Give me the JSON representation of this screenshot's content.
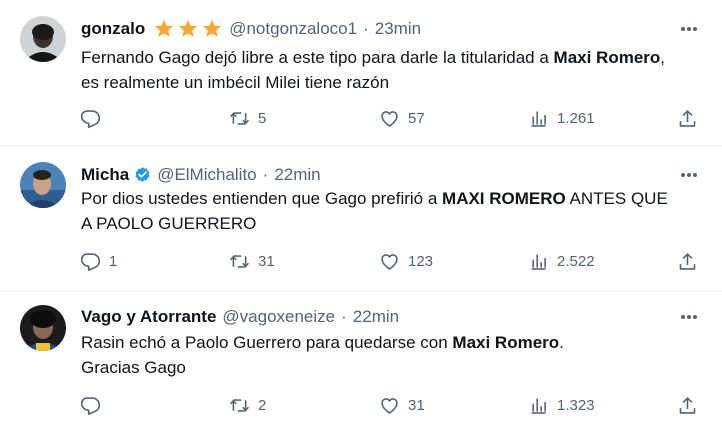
{
  "colors": {
    "star": "#f4a934",
    "verified": "#1d9bf0",
    "text": "#0f1419",
    "muted": "#536471"
  },
  "tweets": [
    {
      "name": "gonzalo",
      "badge": "three-stars",
      "handle": "@notgonzaloco1",
      "sep": "·",
      "time": "23min",
      "text_parts": [
        {
          "t": "Fernando Gago dejó libre a este tipo para darle la titularidad a "
        },
        {
          "t": "Maxi Romero",
          "bold": true
        },
        {
          "t": ", es realmente un imbécil Milei tiene razón"
        }
      ],
      "replies": "",
      "retweets": "5",
      "likes": "57",
      "views": "1.261"
    },
    {
      "name": "Micha",
      "badge": "verified-icon",
      "handle": "@ElMichalito",
      "sep": "·",
      "time": "22min",
      "text_parts": [
        {
          "t": "Por dios ustedes entienden que Gago prefirió a "
        },
        {
          "t": "MAXI ROMERO",
          "bold": true
        },
        {
          "t": " ANTES QUE A PAOLO GUERRERO"
        }
      ],
      "replies": "1",
      "retweets": "31",
      "likes": "123",
      "views": "2.522"
    },
    {
      "name": "Vago y Atorrante",
      "badge": "",
      "handle": "@vagoxeneize",
      "sep": "·",
      "time": "22min",
      "text_parts": [
        {
          "t": "Rasin echó a Paolo Guerrero para quedarse con "
        },
        {
          "t": "Maxi Romero",
          "bold": true
        },
        {
          "t": "."
        },
        {
          "br": true
        },
        {
          "t": "Gracias Gago"
        }
      ],
      "replies": "",
      "retweets": "2",
      "likes": "31",
      "views": "1.323"
    }
  ]
}
